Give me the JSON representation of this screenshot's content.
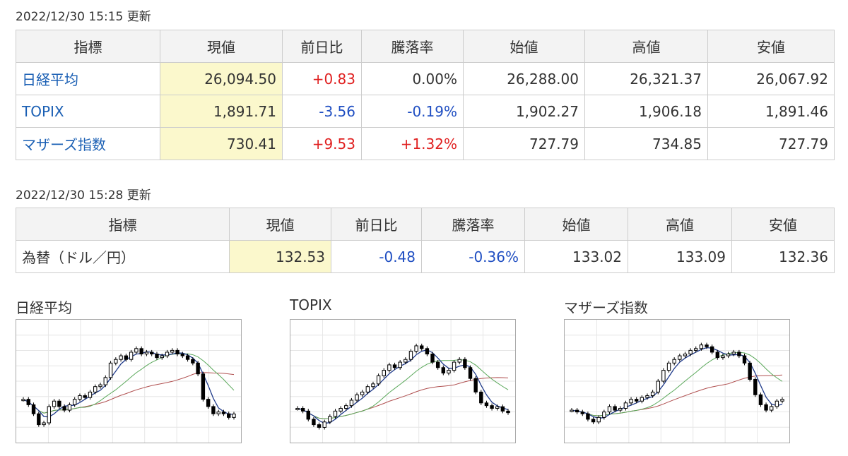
{
  "indices": {
    "timestamp": "2022/12/30 15:15 更新",
    "headers": [
      "指標",
      "現値",
      "前日比",
      "騰落率",
      "始値",
      "高値",
      "安値"
    ],
    "rows": [
      {
        "name": "日経平均",
        "current": "26,094.50",
        "change": "+0.83",
        "change_pct": "0.00%",
        "open": "26,288.00",
        "high": "26,321.37",
        "low": "26,067.92",
        "change_dir": "up",
        "pct_dir": "flat"
      },
      {
        "name": "TOPIX",
        "current": "1,891.71",
        "change": "-3.56",
        "change_pct": "-0.19%",
        "open": "1,902.27",
        "high": "1,906.18",
        "low": "1,891.46",
        "change_dir": "down",
        "pct_dir": "down"
      },
      {
        "name": "マザーズ指数",
        "current": "730.41",
        "change": "+9.53",
        "change_pct": "+1.32%",
        "open": "727.79",
        "high": "734.85",
        "low": "727.79",
        "change_dir": "up",
        "pct_dir": "up"
      }
    ]
  },
  "fx": {
    "timestamp": "2022/12/30 15:28 更新",
    "headers": [
      "指標",
      "現値",
      "前日比",
      "騰落率",
      "始値",
      "高値",
      "安値"
    ],
    "rows": [
      {
        "name": "為替（ドル／円）",
        "current": "132.53",
        "change": "-0.48",
        "change_pct": "-0.36%",
        "open": "133.02",
        "high": "133.09",
        "low": "132.36",
        "change_dir": "down",
        "pct_dir": "down"
      }
    ]
  },
  "colors": {
    "up": "#e02020",
    "down": "#1f4ec2",
    "link": "#1a5fb4",
    "current_bg": "#fbf8cc",
    "ma_short": "#1f3a8a",
    "ma_mid": "#5aa85a",
    "ma_long": "#b05050"
  },
  "chart_data": [
    {
      "type": "candlestick",
      "title": "日経平均",
      "grid": true,
      "ylim": [
        25500,
        28500
      ],
      "series": [
        {
          "name": "",
          "values": [
            26500,
            26350,
            26100,
            25800,
            25850,
            26300,
            26450,
            26300,
            26200,
            26350,
            26500,
            26600,
            26550,
            26700,
            26850,
            26900,
            27100,
            27500,
            27600,
            27700,
            27600,
            27800,
            27900,
            27750,
            27800,
            27750,
            27650,
            27700,
            27800,
            27850,
            27750,
            27700,
            27600,
            27500,
            27200,
            26500,
            26300,
            26100,
            26150,
            26100,
            26000,
            26094
          ]
        }
      ]
    },
    {
      "type": "candlestick",
      "title": "TOPIX",
      "grid": true,
      "ylim": [
        1850,
        2050
      ],
      "series": [
        {
          "name": "",
          "values": [
            1900,
            1895,
            1880,
            1870,
            1865,
            1875,
            1885,
            1895,
            1900,
            1905,
            1915,
            1925,
            1930,
            1940,
            1945,
            1960,
            1970,
            1980,
            1975,
            1985,
            1990,
            2005,
            2015,
            2010,
            2000,
            1985,
            1975,
            1965,
            1970,
            1985,
            1990,
            1975,
            1955,
            1930,
            1910,
            1905,
            1900,
            1903,
            1895,
            1892
          ]
        }
      ]
    },
    {
      "type": "candlestick",
      "title": "マザーズ指数",
      "grid": true,
      "ylim": [
        690,
        810
      ],
      "series": [
        {
          "name": "",
          "values": [
            718,
            716,
            714,
            708,
            705,
            710,
            716,
            722,
            718,
            720,
            726,
            730,
            728,
            732,
            734,
            738,
            750,
            762,
            770,
            774,
            778,
            780,
            784,
            786,
            790,
            788,
            782,
            776,
            778,
            780,
            782,
            778,
            770,
            752,
            735,
            724,
            718,
            722,
            728,
            730
          ]
        }
      ]
    }
  ]
}
